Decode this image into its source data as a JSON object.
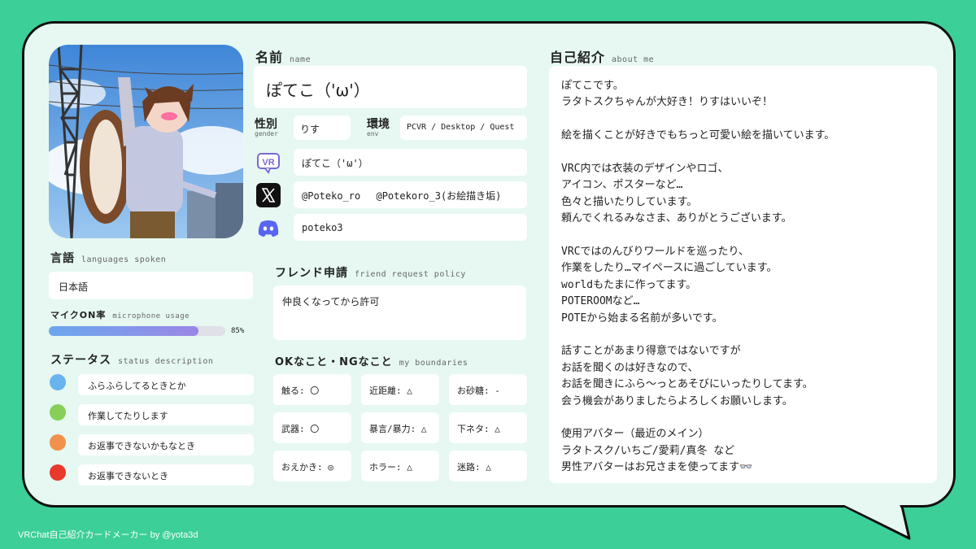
{
  "footer": "VRChat自己紹介カードメーカー by @yota3d",
  "name": {
    "label": "名前",
    "sub": "name",
    "value": "ぽてこ（'ω'）"
  },
  "gender": {
    "label": "性別",
    "sub": "gender",
    "value": "りす"
  },
  "env": {
    "label": "環境",
    "sub": "env",
    "value": "PCVR / Desktop / Quest"
  },
  "accounts": {
    "vrchat": "ぽてこ（'ω'）",
    "x": "@Poteko_ro　 @Potekoro_3(お絵描き垢)",
    "discord": "poteko3",
    "vr_badge": "VR"
  },
  "languages": {
    "label": "言語",
    "sub": "languages spoken",
    "value": "日本語"
  },
  "mic": {
    "label": "マイクON率",
    "sub": "microphone usage",
    "percent": 85,
    "percent_text": "85%"
  },
  "status": {
    "label": "ステータス",
    "sub": "status description",
    "items": [
      {
        "color": "#6ab4ee",
        "text": "ふらふらしてるときとか"
      },
      {
        "color": "#86d05a",
        "text": "作業してたりします"
      },
      {
        "color": "#f2914b",
        "text": "お返事できないかもなとき"
      },
      {
        "color": "#e8392c",
        "text": "お返事できないとき"
      }
    ]
  },
  "friend": {
    "label": "フレンド申請",
    "sub": "friend request policy",
    "value": "仲良くなってから許可"
  },
  "boundaries": {
    "label": "OKなこと・NGなこと",
    "sub": "my boundaries",
    "items": [
      "触る: 〇",
      "近距離: △",
      "お砂糖: -",
      "武器: 〇",
      "暴言/暴力: △",
      "下ネタ: △",
      "おえかき: ◎",
      "ホラー: △",
      "迷路: △"
    ]
  },
  "about": {
    "label": "自己紹介",
    "sub": "about me",
    "lines": [
      "ぽてこです。",
      "ラタトスクちゃんが大好き！りすはいいぞ！",
      "",
      "絵を描くことが好きでもちっと可愛い絵を描いています。",
      "",
      "VRC内では衣装のデザインやロゴ、",
      "アイコン、ポスターなど…",
      "色々と描いたりしています。",
      "頼んでくれるみなさま、ありがとうございます。",
      "",
      "VRCではのんびりワールドを巡ったり、",
      "作業をしたり…マイペースに過ごしています。",
      "worldもたまに作ってます。",
      "POTEROOMなど…",
      "POTEから始まる名前が多いです。",
      "",
      "話すことがあまり得意ではないですが",
      "お話を聞くのは好きなので、",
      "お話を聞きにふら～っとあそびにいったりしてます。",
      "会う機会がありましたらよろしくお願いします。",
      "",
      "使用アバター（最近のメイン）",
      "ラタトスク/いちご/愛莉/真冬 など",
      "男性アバターはお兄さまを使ってます👓"
    ]
  }
}
